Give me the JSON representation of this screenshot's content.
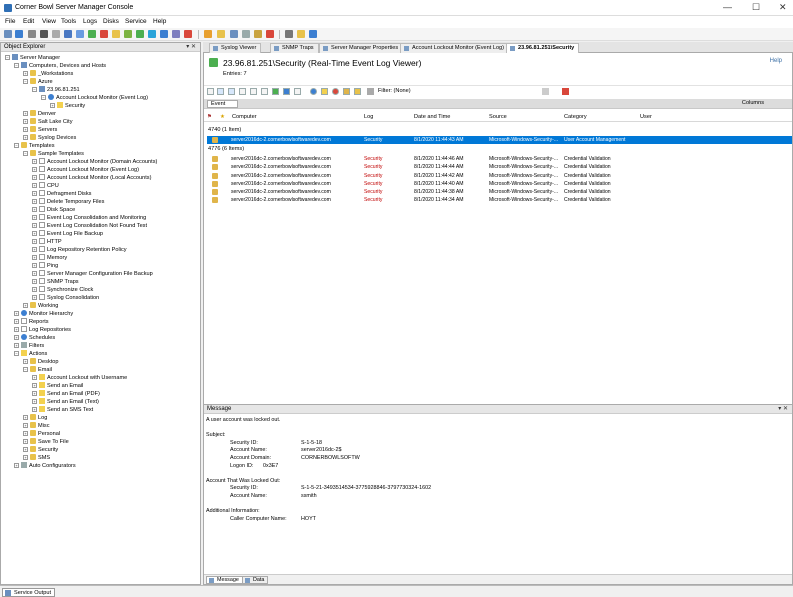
{
  "window": {
    "title": "Corner Bowl Server Manager Console",
    "minimize": "—",
    "maximize": "☐",
    "close": "✕"
  },
  "menu": [
    "File",
    "Edit",
    "View",
    "Tools",
    "Logs",
    "Disks",
    "Service",
    "Help"
  ],
  "object_explorer": {
    "title": "Object Explorer",
    "controls": "▾ ✕",
    "tree": [
      {
        "label": "Server Manager",
        "level": 0,
        "icon": "comp"
      },
      {
        "label": "Computers, Devices and Hosts",
        "level": 1,
        "icon": "comp"
      },
      {
        "label": "_Workstations",
        "level": 2,
        "icon": "folder"
      },
      {
        "label": "Azure",
        "level": 2,
        "icon": "folder"
      },
      {
        "label": "23.96.81.251",
        "level": 3,
        "icon": "comp"
      },
      {
        "label": "Account Lockout Monitor (Event Log)",
        "level": 4,
        "icon": "blue"
      },
      {
        "label": "Security",
        "level": 5,
        "icon": "yellow"
      },
      {
        "label": "Denver",
        "level": 2,
        "icon": "folder"
      },
      {
        "label": "Salt Lake City",
        "level": 2,
        "icon": "folder"
      },
      {
        "label": "Servers",
        "level": 2,
        "icon": "folder"
      },
      {
        "label": "Syslog Devices",
        "level": 2,
        "icon": "folder"
      },
      {
        "label": "Templates",
        "level": 1,
        "icon": "folder"
      },
      {
        "label": "Sample Templates",
        "level": 2,
        "icon": "folder"
      },
      {
        "label": "Account Lockout Monitor (Domain Accounts)",
        "level": 3,
        "icon": "doc"
      },
      {
        "label": "Account Lockout Monitor (Event Log)",
        "level": 3,
        "icon": "doc"
      },
      {
        "label": "Account Lockout Monitor (Local Accounts)",
        "level": 3,
        "icon": "doc"
      },
      {
        "label": "CPU",
        "level": 3,
        "icon": "doc"
      },
      {
        "label": "Defragment Disks",
        "level": 3,
        "icon": "doc"
      },
      {
        "label": "Delete Temporary Files",
        "level": 3,
        "icon": "doc"
      },
      {
        "label": "Disk Space",
        "level": 3,
        "icon": "doc"
      },
      {
        "label": "Event Log Consolidation and Monitoring",
        "level": 3,
        "icon": "doc"
      },
      {
        "label": "Event Log Consolidation Not Found Test",
        "level": 3,
        "icon": "doc"
      },
      {
        "label": "Event Log File Backup",
        "level": 3,
        "icon": "doc"
      },
      {
        "label": "HTTP",
        "level": 3,
        "icon": "doc"
      },
      {
        "label": "Log Repository Retention Policy",
        "level": 3,
        "icon": "doc"
      },
      {
        "label": "Memory",
        "level": 3,
        "icon": "doc"
      },
      {
        "label": "Ping",
        "level": 3,
        "icon": "doc"
      },
      {
        "label": "Server Manager Configuration File Backup",
        "level": 3,
        "icon": "doc"
      },
      {
        "label": "SNMP Traps",
        "level": 3,
        "icon": "doc"
      },
      {
        "label": "Synchronize Clock",
        "level": 3,
        "icon": "doc"
      },
      {
        "label": "Syslog Consolidation",
        "level": 3,
        "icon": "doc"
      },
      {
        "label": "Working",
        "level": 2,
        "icon": "folder"
      },
      {
        "label": "Monitor Hierarchy",
        "level": 1,
        "icon": "blue"
      },
      {
        "label": "Reports",
        "level": 1,
        "icon": "doc"
      },
      {
        "label": "Log Repositories",
        "level": 1,
        "icon": "doc"
      },
      {
        "label": "Schedules",
        "level": 1,
        "icon": "blue"
      },
      {
        "label": "Filters",
        "level": 1,
        "icon": "gray"
      },
      {
        "label": "Actions",
        "level": 1,
        "icon": "yellow"
      },
      {
        "label": "Desktop",
        "level": 2,
        "icon": "folder"
      },
      {
        "label": "Email",
        "level": 2,
        "icon": "folder"
      },
      {
        "label": "Account Lockout with Username",
        "level": 3,
        "icon": "yellow"
      },
      {
        "label": "Send an Email",
        "level": 3,
        "icon": "yellow"
      },
      {
        "label": "Send an Email (PDF)",
        "level": 3,
        "icon": "yellow"
      },
      {
        "label": "Send an Email (Text)",
        "level": 3,
        "icon": "yellow"
      },
      {
        "label": "Send an SMS Text",
        "level": 3,
        "icon": "yellow"
      },
      {
        "label": "Log",
        "level": 2,
        "icon": "folder"
      },
      {
        "label": "Misc",
        "level": 2,
        "icon": "folder"
      },
      {
        "label": "Personal",
        "level": 2,
        "icon": "folder"
      },
      {
        "label": "Save To File",
        "level": 2,
        "icon": "folder"
      },
      {
        "label": "Security",
        "level": 2,
        "icon": "folder"
      },
      {
        "label": "SMS",
        "level": 2,
        "icon": "folder"
      },
      {
        "label": "Auto Configurators",
        "level": 1,
        "icon": "gray"
      }
    ]
  },
  "tabs": [
    {
      "label": "Syslog Viewer",
      "active": false
    },
    {
      "label": "SNMP Traps",
      "active": false
    },
    {
      "label": "Server Manager Properties",
      "active": false
    },
    {
      "label": "Account Lockout Monitor (Event Log)",
      "active": false
    },
    {
      "label": "23.96.81.251\\Security",
      "active": true
    }
  ],
  "viewer": {
    "title": "23.96.81.251\\Security (Real-Time Event Log Viewer)",
    "entries": "Entries: 7",
    "help": "Help",
    "filter": "Filter: (None)",
    "group_chip": "Event",
    "columns_button": "Columns",
    "columns": [
      "Computer",
      "Log",
      "Date and Time",
      "Source",
      "Category",
      "User"
    ],
    "groups": [
      {
        "label": "4740 (1 Item)",
        "rows": [
          {
            "computer": "server2016dc-2.cornerbowlsoftwaredev.com",
            "log": "Security",
            "datetime": "8/1/2020 11:44:43 AM",
            "source": "Microsoft-Windows-Security-...",
            "category": "User Account Management",
            "user": "",
            "selected": true
          }
        ]
      },
      {
        "label": "4776 (6 Items)",
        "rows": [
          {
            "computer": "server2016dc-2.cornerbowlsoftwaredev.com",
            "log": "Security",
            "datetime": "8/1/2020 11:44:46 AM",
            "source": "Microsoft-Windows-Security-...",
            "category": "Credential Validation",
            "user": "",
            "selected": false
          },
          {
            "computer": "server2016dc-2.cornerbowlsoftwaredev.com",
            "log": "Security",
            "datetime": "8/1/2020 11:44:44 AM",
            "source": "Microsoft-Windows-Security-...",
            "category": "Credential Validation",
            "user": "",
            "selected": false
          },
          {
            "computer": "server2016dc-2.cornerbowlsoftwaredev.com",
            "log": "Security",
            "datetime": "8/1/2020 11:44:42 AM",
            "source": "Microsoft-Windows-Security-...",
            "category": "Credential Validation",
            "user": "",
            "selected": false
          },
          {
            "computer": "server2016dc-2.cornerbowlsoftwaredev.com",
            "log": "Security",
            "datetime": "8/1/2020 11:44:40 AM",
            "source": "Microsoft-Windows-Security-...",
            "category": "Credential Validation",
            "user": "",
            "selected": false
          },
          {
            "computer": "server2016dc-2.cornerbowlsoftwaredev.com",
            "log": "Security",
            "datetime": "8/1/2020 11:44:38 AM",
            "source": "Microsoft-Windows-Security-...",
            "category": "Credential Validation",
            "user": "",
            "selected": false
          },
          {
            "computer": "server2016dc-2.cornerbowlsoftwaredev.com",
            "log": "Security",
            "datetime": "8/1/2020 11:44:34 AM",
            "source": "Microsoft-Windows-Security-...",
            "category": "Credential Validation",
            "user": "",
            "selected": false
          }
        ]
      }
    ]
  },
  "message": {
    "title": "Message",
    "controls": "▾ ✕",
    "lines": [
      {
        "text": "A user account was locked out.",
        "indent": 0
      },
      {
        "text": "",
        "indent": 0
      },
      {
        "text": "Subject:",
        "indent": 0
      },
      {
        "text": "Security ID:",
        "value": "S-1-5-18",
        "indent": 1
      },
      {
        "text": "Account Name:",
        "value": "server2016dc-2$",
        "indent": 1
      },
      {
        "text": "Account Domain:",
        "value": "CORNERBOWLSOFTW",
        "indent": 1
      },
      {
        "text": "Logon ID:",
        "value": "0x3E7",
        "indent": 1,
        "short": true
      },
      {
        "text": "",
        "indent": 0
      },
      {
        "text": "Account That Was Locked Out:",
        "indent": 0
      },
      {
        "text": "Security ID:",
        "value": "S-1-5-21-3493514534-3775928846-3797730324-1602",
        "indent": 1
      },
      {
        "text": "Account Name:",
        "value": "ssmith",
        "indent": 1
      },
      {
        "text": "",
        "indent": 0
      },
      {
        "text": "Additional Information:",
        "indent": 0
      },
      {
        "text": "Caller Computer Name:",
        "value": "HOYT",
        "indent": 1
      }
    ],
    "tabs": [
      "Message",
      "Data"
    ]
  },
  "status_bar": {
    "service_output": "Service Output"
  },
  "colors": {
    "selection": "#0078d7",
    "security_log": "#c00000"
  }
}
